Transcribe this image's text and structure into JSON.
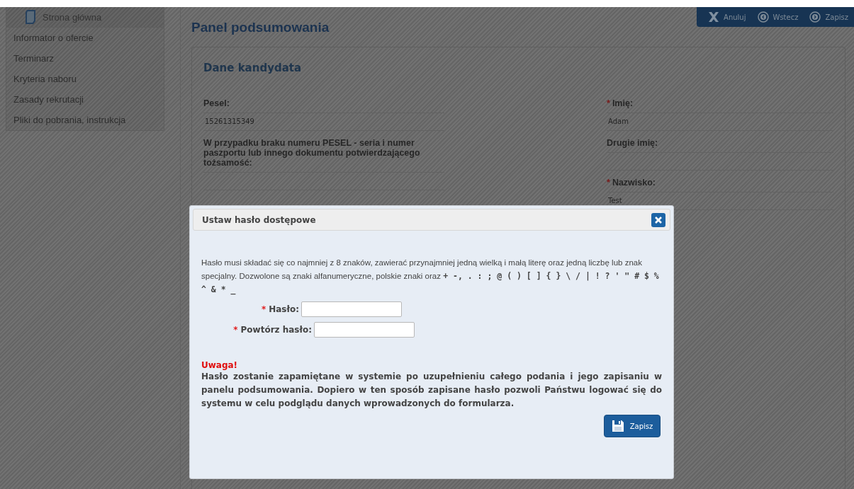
{
  "sidebar": {
    "items": [
      {
        "label": "Strona główna",
        "kind": "home"
      },
      {
        "label": "Informator o ofercie",
        "kind": "link"
      },
      {
        "label": "Terminarz",
        "kind": "link"
      },
      {
        "label": "Kryteria naboru",
        "kind": "link"
      },
      {
        "label": "Zasady rekrutacji",
        "kind": "link"
      },
      {
        "label": "Pliki do pobrania, instrukcja",
        "kind": "link"
      }
    ]
  },
  "toolbar": [
    {
      "label": "Anuluj",
      "kind": "cancel"
    },
    {
      "label": "Wstecz",
      "kind": "back"
    },
    {
      "label": "Zapisz",
      "kind": "next"
    }
  ],
  "page_title": "Panel podsumowania",
  "section": {
    "title": "Dane kandydata",
    "left_fields": [
      {
        "label": "Pesel:",
        "value": "15261315349"
      },
      {
        "label": "W przypadku braku numeru PESEL - seria i numer paszportu lub innego dokumentu potwierdzającego tożsamość:"
      }
    ],
    "right_fields": [
      {
        "label": "Imię:",
        "required_mark": "*",
        "value": "Adam"
      },
      {
        "label": "Drugie imię:"
      },
      {
        "label": "Nazwisko:",
        "required_mark": "*",
        "value": "Test"
      }
    ]
  },
  "dialog": {
    "title": "Ustaw hasło dostępowe",
    "info": "Hasło musi składać się co najmniej z 8 znaków, zawierać przynajmniej jedną wielką i małą literę oraz jedną liczbę lub znak specjalny. Dozwolone są znaki alfanumeryczne, polskie znaki oraz",
    "special_chars": "+ -, . : ; @ ( ) [ ] { } \\ / | ! ? ' \" # $ % ^ & * _",
    "fields": [
      {
        "label": "Hasło:",
        "required_mark": "*"
      },
      {
        "label": "Powtórz hasło:",
        "required_mark": "*"
      }
    ],
    "warning_title": "Uwaga!",
    "warning_text": "Hasło zostanie zapamiętane w systemie po uzupełnieniu całego podania i jego zapisaniu w panelu podsumowania. Dopiero w ten sposób zapisane hasło pozwoli Państwu logować się do systemu w celu podglądu danych wprowadzonych do formularza.",
    "save_button": "Zapisz"
  }
}
